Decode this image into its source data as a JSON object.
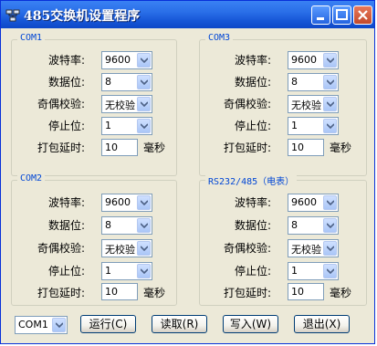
{
  "window": {
    "title": "485交换机设置程序"
  },
  "groups": [
    {
      "title": "COM1",
      "baud_label": "波特率:",
      "baud": "9600",
      "databits_label": "数据位:",
      "databits": "8",
      "parity_label": "奇偶校验:",
      "parity": "无校验",
      "stopbits_label": "停止位:",
      "stopbits": "1",
      "delay_label": "打包延时:",
      "delay": "10",
      "delay_unit": "毫秒"
    },
    {
      "title": "COM3",
      "baud_label": "波特率:",
      "baud": "9600",
      "databits_label": "数据位:",
      "databits": "8",
      "parity_label": "奇偶校验:",
      "parity": "无校验",
      "stopbits_label": "停止位:",
      "stopbits": "1",
      "delay_label": "打包延时:",
      "delay": "10",
      "delay_unit": "毫秒"
    },
    {
      "title": "COM2",
      "baud_label": "波特率:",
      "baud": "9600",
      "databits_label": "数据位:",
      "databits": "8",
      "parity_label": "奇偶校验:",
      "parity": "无校验",
      "stopbits_label": "停止位:",
      "stopbits": "1",
      "delay_label": "打包延时:",
      "delay": "10",
      "delay_unit": "毫秒"
    },
    {
      "title": "RS232/485（电表）",
      "baud_label": "波特率:",
      "baud": "9600",
      "databits_label": "数据位:",
      "databits": "8",
      "parity_label": "奇偶校验:",
      "parity": "无校验",
      "stopbits_label": "停止位:",
      "stopbits": "1",
      "delay_label": "打包延时:",
      "delay": "10",
      "delay_unit": "毫秒"
    }
  ],
  "bottom": {
    "port": "COM1",
    "run": "运行(C)",
    "read": "读取(R)",
    "write": "写入(W)",
    "exit": "退出(X)"
  }
}
